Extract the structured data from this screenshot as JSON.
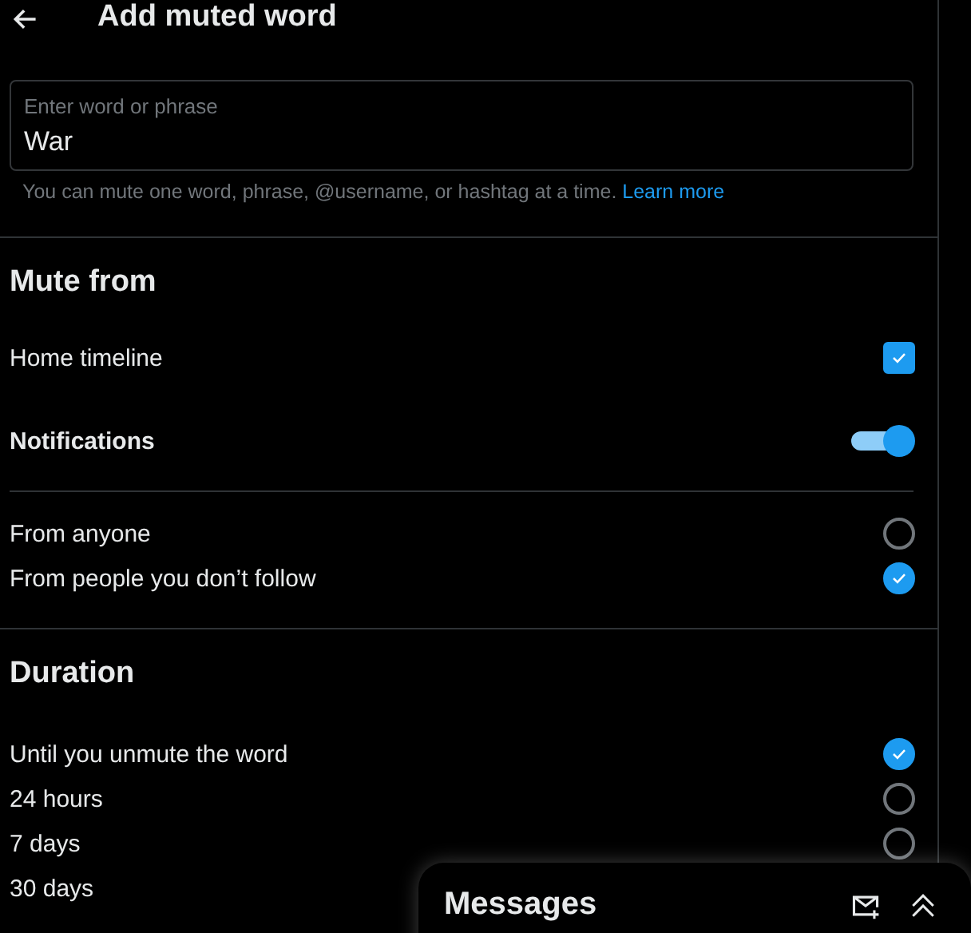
{
  "header": {
    "title": "Add muted word"
  },
  "word_field": {
    "label": "Enter word or phrase",
    "value": "War"
  },
  "hint": {
    "text": "You can mute one word, phrase, @username, or hashtag at a time.",
    "link": "Learn more"
  },
  "mute_from": {
    "heading": "Mute from",
    "home_timeline": {
      "label": "Home timeline",
      "checked": true
    },
    "notifications": {
      "label": "Notifications",
      "on": true
    },
    "audience": [
      {
        "label": "From anyone",
        "selected": false
      },
      {
        "label": "From people you don’t follow",
        "selected": true
      }
    ]
  },
  "duration": {
    "heading": "Duration",
    "options": [
      {
        "label": "Until you unmute the word",
        "selected": true
      },
      {
        "label": "24 hours",
        "selected": false
      },
      {
        "label": "7 days",
        "selected": false
      },
      {
        "label": "30 days"
      }
    ]
  },
  "messages_drawer": {
    "title": "Messages"
  }
}
